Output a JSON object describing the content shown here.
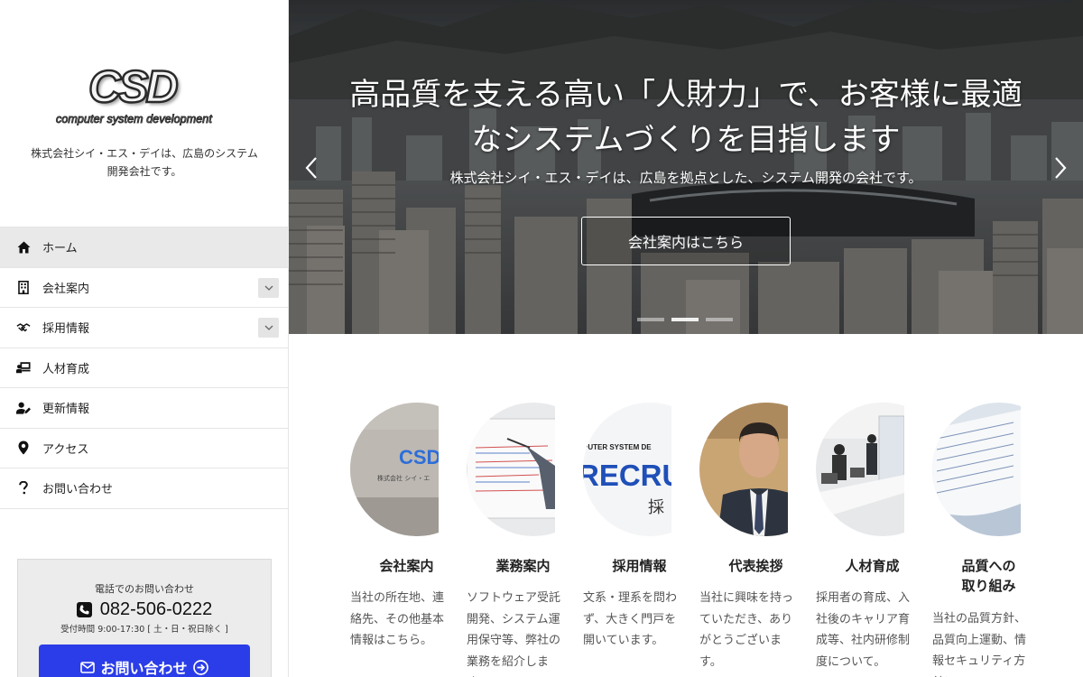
{
  "sidebar": {
    "logo": {
      "main": "CSD",
      "sub": "computer system development"
    },
    "description": "株式会社シイ・エス・デイは、広島のシステム開発会社です。",
    "nav": [
      {
        "label": "ホーム",
        "icon": "home-icon",
        "active": true,
        "expandable": false
      },
      {
        "label": "会社案内",
        "icon": "building-icon",
        "active": false,
        "expandable": true
      },
      {
        "label": "採用情報",
        "icon": "handshake-icon",
        "active": false,
        "expandable": true
      },
      {
        "label": "人材育成",
        "icon": "training-icon",
        "active": false,
        "expandable": false
      },
      {
        "label": "更新情報",
        "icon": "user-edit-icon",
        "active": false,
        "expandable": false
      },
      {
        "label": "アクセス",
        "icon": "map-pin-icon",
        "active": false,
        "expandable": false
      },
      {
        "label": "お問い合わせ",
        "icon": "question-icon",
        "active": false,
        "expandable": false
      }
    ],
    "contact": {
      "title": "電話でのお問い合わせ",
      "phone": "082-506-0222",
      "hours": "受付時間 9:00-17:30 [ 土・日・祝日除く ]",
      "button_label": "お問い合わせ"
    }
  },
  "hero": {
    "title_line1": "高品質を支える高い「人財力」で、お客様に最適",
    "title_line2": "なシステムづくりを目指します",
    "subtitle": "株式会社シイ・エス・デイは、広島を拠点とした、システム開発の会社です。",
    "button_label": "会社案内はこちら",
    "slide_count": 3,
    "active_slide": 1
  },
  "cards": [
    {
      "title": "会社案内",
      "text": "当社の所在地、連絡先、その他基本情報はこちら。",
      "image": "office-sign"
    },
    {
      "title": "業務案内",
      "text": "ソフトウェア受託開発、システム運用保守等、弊社の業務を紹介します。",
      "image": "presentation"
    },
    {
      "title": "採用情報",
      "text": "文系・理系を問わず、大きく門戸を開いています。",
      "image": "recruit"
    },
    {
      "title": "代表挨拶",
      "text": "当社に興味を持っていただき、ありがとうございます。",
      "image": "president"
    },
    {
      "title": "人材育成",
      "text": "採用者の育成、入社後のキャリア育成等、社内研修制度について。",
      "image": "training-room"
    },
    {
      "title": "品質への\n取り組み",
      "text": "当社の品質方針、品質向上運動、情報セキュリティ方針について。",
      "image": "documents"
    }
  ],
  "colors": {
    "accent": "#2b3de8",
    "active_nav": "#e9e9e9"
  }
}
